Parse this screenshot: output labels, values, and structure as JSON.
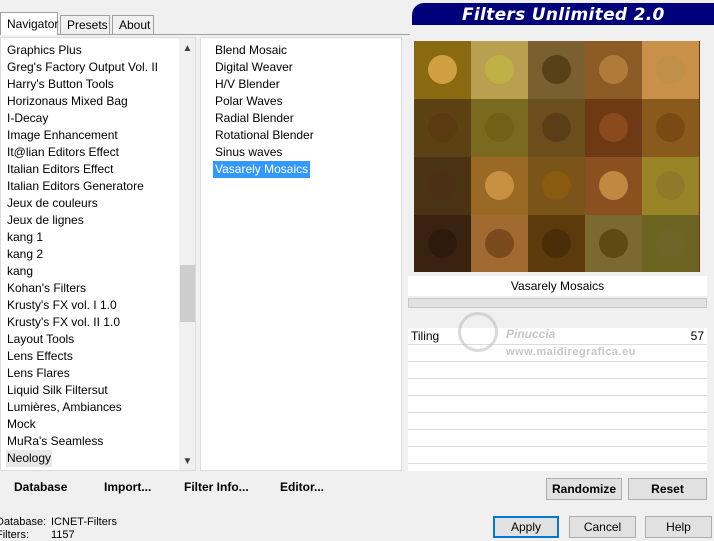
{
  "tabs": [
    "Navigator",
    "Presets",
    "About"
  ],
  "banner_title": "Filters Unlimited 2.0",
  "categories": [
    "Graphics Plus",
    "Greg's Factory Output Vol. II",
    "Harry's Button Tools",
    "Horizonaus Mixed Bag",
    "I-Decay",
    "Image Enhancement",
    "It@lian Editors Effect",
    "Italian Editors Effect",
    "Italian Editors Generatore",
    "Jeux de couleurs",
    "Jeux de lignes",
    "kang 1",
    "kang 2",
    "kang",
    "Kohan's Filters",
    "Krusty's FX vol. I 1.0",
    "Krusty's FX vol. II 1.0",
    "Layout Tools",
    "Lens Effects",
    "Lens Flares",
    "Liquid Silk Filtersut",
    "Lumières, Ambiances",
    "Mock",
    "MuRa's Seamless",
    "Neology"
  ],
  "selected_category": "Neology",
  "filters": [
    "Blend Mosaic",
    "Digital Weaver",
    "H/V Blender",
    "Polar Waves",
    "Radial Blender",
    "Rotational Blender",
    "Sinus waves",
    "Vasarely Mosaics"
  ],
  "selected_filter": "Vasarely Mosaics",
  "filter_name": "Vasarely Mosaics",
  "params": [
    {
      "label": "Tiling",
      "value": "57"
    }
  ],
  "watermark": {
    "line1": "Pinuccia",
    "line2": "www.maidiregrafica.eu"
  },
  "buttons": {
    "database": "Database",
    "import": "Import...",
    "filter_info": "Filter Info...",
    "editor": "Editor...",
    "randomize": "Randomize",
    "reset": "Reset",
    "apply": "Apply",
    "cancel": "Cancel",
    "help": "Help"
  },
  "info": {
    "database_label": "Database:",
    "database_value": "ICNET-Filters",
    "filters_label": "Filters:",
    "filters_value": "1157"
  },
  "preview_tiles": [
    [
      "#8a6a10",
      "#d0a040",
      "#b8a050",
      "#c0b045",
      "#7a6030",
      "#584018",
      "#8c5a24",
      "#b07a38",
      "#c89048",
      "#c0904a"
    ],
    [
      "#5c4212",
      "#5a3a10",
      "#7a6a20",
      "#706018",
      "#6c4e1c",
      "#5a3e18",
      "#6e3a14",
      "#8a4a1c",
      "#8a5a1c",
      "#7a4a14"
    ],
    [
      "#4a3214",
      "#4c3016",
      "#9a6a24",
      "#c89040",
      "#7a5418",
      "#8a5a10",
      "#8a5020",
      "#c08840",
      "#9a8428",
      "#907a2a"
    ],
    [
      "#3a2210",
      "#2e1a0c",
      "#a06a30",
      "#7a4a1c",
      "#5c3a0c",
      "#4a2e0a",
      "#7a6a30",
      "#5c4c14",
      "#6c6420",
      "#6e6428"
    ]
  ]
}
